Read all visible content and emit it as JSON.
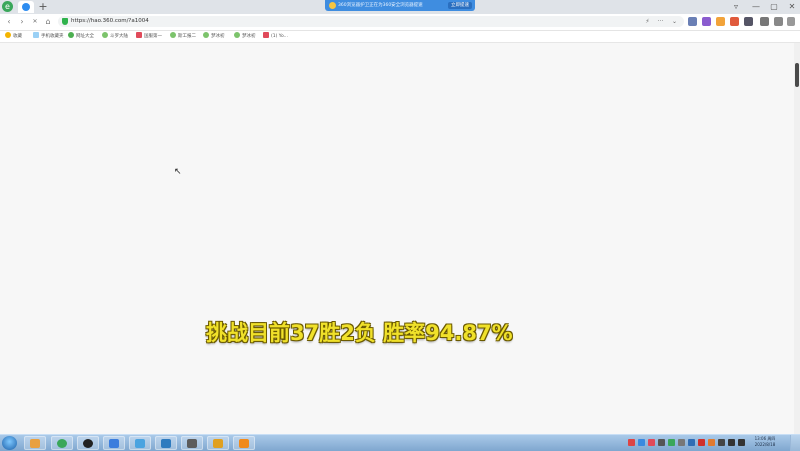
{
  "tabstrip": {
    "new_tab_label": "+",
    "notice": {
      "text": "360浏览器护卫正在为360安全浏览器提速",
      "button_label": "立即提速"
    },
    "window_buttons": [
      "▿",
      "—",
      "▢",
      "✕"
    ]
  },
  "nav": {
    "back": "‹",
    "forward": "›",
    "stop": "✕",
    "home": "⌂",
    "url": "https://hao.360.com/?a1004",
    "lightning": "⚡",
    "more": "···",
    "dropdown": "⌄"
  },
  "bookmarks": [
    {
      "label": "收藏",
      "color": "#f4b400"
    },
    {
      "label": "手机收藏夹",
      "color": "#9ad0f5"
    },
    {
      "label": "网址大全",
      "color": "#4caf50"
    },
    {
      "label": "斗罗大陆",
      "color": "#7cc36b"
    },
    {
      "label": "国服第一",
      "color": "#e04a5a"
    },
    {
      "label": "斯工报二",
      "color": "#7cc36b"
    },
    {
      "label": "梦冰初",
      "color": "#7cc36b"
    },
    {
      "label": "梦冰初",
      "color": "#7cc36b"
    },
    {
      "label": "(1) Yo...",
      "color": "#e04a5a"
    }
  ],
  "content": {
    "caption": "挑战目前37胜2负 胜率94.87%"
  },
  "taskbar": {
    "clock_time": "13:06 周四",
    "clock_date": "2022/8/18",
    "apps": [
      {
        "name": "taskbar-app-browser",
        "color": "#3aa75a"
      },
      {
        "name": "taskbar-app-obs",
        "color": "#222222"
      },
      {
        "name": "taskbar-app-feishu",
        "color": "#3b7ddd"
      },
      {
        "name": "taskbar-app-bird",
        "color": "#4aa3e0"
      },
      {
        "name": "taskbar-app-gallery",
        "color": "#2e7bbf"
      },
      {
        "name": "taskbar-app-game",
        "color": "#5c5c5c"
      },
      {
        "name": "taskbar-app-emulator",
        "color": "#e0a020"
      },
      {
        "name": "taskbar-app-help",
        "color": "#f08a1c"
      }
    ]
  }
}
